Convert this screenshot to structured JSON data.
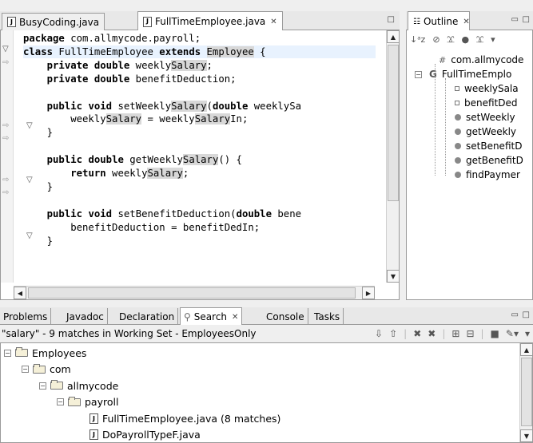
{
  "editor": {
    "tabs": [
      {
        "label": "BusyCoding.java",
        "active": false
      },
      {
        "label": "FullTimeEmployee.java",
        "active": true
      }
    ],
    "code": [
      [
        [
          "kw",
          "package"
        ],
        [
          "",
          " com.allmycode.payroll;"
        ]
      ],
      [
        [
          "kw",
          "class"
        ],
        [
          "",
          " FullTimeEmployee "
        ],
        [
          "kw",
          "extends"
        ],
        [
          "",
          " "
        ],
        [
          "hl",
          "Employee"
        ],
        [
          "",
          " {"
        ]
      ],
      [
        [
          "",
          "    "
        ],
        [
          "kw",
          "private"
        ],
        [
          "",
          " "
        ],
        [
          "kw",
          "double"
        ],
        [
          "",
          " weekly"
        ],
        [
          "hl",
          "Salary"
        ],
        [
          "",
          ";"
        ]
      ],
      [
        [
          "",
          "    "
        ],
        [
          "kw",
          "private"
        ],
        [
          "",
          " "
        ],
        [
          "kw",
          "double"
        ],
        [
          "",
          " benefitDeduction;"
        ]
      ],
      [
        [
          "",
          ""
        ]
      ],
      [
        [
          "",
          "    "
        ],
        [
          "kw",
          "public"
        ],
        [
          "",
          " "
        ],
        [
          "kw",
          "void"
        ],
        [
          "",
          " setWeekly"
        ],
        [
          "hl",
          "Salary"
        ],
        [
          "",
          "("
        ],
        [
          "kw",
          "double"
        ],
        [
          "",
          " weeklySa"
        ]
      ],
      [
        [
          "",
          "        weekly"
        ],
        [
          "hl",
          "Salary"
        ],
        [
          "",
          " = weekly"
        ],
        [
          "hl",
          "Salary"
        ],
        [
          "",
          "In;"
        ]
      ],
      [
        [
          "",
          "    }"
        ]
      ],
      [
        [
          "",
          ""
        ]
      ],
      [
        [
          "",
          "    "
        ],
        [
          "kw",
          "public"
        ],
        [
          "",
          " "
        ],
        [
          "kw",
          "double"
        ],
        [
          "",
          " getWeekly"
        ],
        [
          "hl",
          "Salary"
        ],
        [
          "",
          "() {"
        ]
      ],
      [
        [
          "",
          "        "
        ],
        [
          "kw",
          "return"
        ],
        [
          "",
          " weekly"
        ],
        [
          "hl",
          "Salary"
        ],
        [
          "",
          ";"
        ]
      ],
      [
        [
          "",
          "    }"
        ]
      ],
      [
        [
          "",
          ""
        ]
      ],
      [
        [
          "",
          "    "
        ],
        [
          "kw",
          "public"
        ],
        [
          "",
          " "
        ],
        [
          "kw",
          "void"
        ],
        [
          "",
          " setBenefitDeduction("
        ],
        [
          "kw",
          "double"
        ],
        [
          "",
          " bene"
        ]
      ],
      [
        [
          "",
          "        benefitDeduction = benefitDedIn;"
        ]
      ],
      [
        [
          "",
          "    }"
        ]
      ]
    ]
  },
  "outline": {
    "tab_label": "Outline",
    "items": [
      {
        "label": "com.allmycode",
        "kind": "package"
      },
      {
        "label": "FullTimeEmplo",
        "kind": "class"
      },
      {
        "label": "weeklySala",
        "kind": "field"
      },
      {
        "label": "benefitDed",
        "kind": "field"
      },
      {
        "label": "setWeekly",
        "kind": "method"
      },
      {
        "label": "getWeekly",
        "kind": "method"
      },
      {
        "label": "setBenefitD",
        "kind": "method"
      },
      {
        "label": "getBenefitD",
        "kind": "method"
      },
      {
        "label": "findPaymer",
        "kind": "method"
      }
    ]
  },
  "bottom": {
    "tabs": [
      "Problems",
      "Javadoc",
      "Declaration",
      "Search",
      "Console",
      "Tasks"
    ],
    "active_tab": "Search",
    "search_summary": "\"salary\" - 9 matches in Working Set - EmployeesOnly",
    "tree": [
      {
        "label": "Employees",
        "level": 0,
        "kind": "project"
      },
      {
        "label": "com",
        "level": 1,
        "kind": "folder"
      },
      {
        "label": "allmycode",
        "level": 2,
        "kind": "folder"
      },
      {
        "label": "payroll",
        "level": 3,
        "kind": "folder"
      },
      {
        "label": "FullTimeEmployee.java (8 matches)",
        "level": 4,
        "kind": "file"
      },
      {
        "label": "DoPayrollTypeF.java",
        "level": 4,
        "kind": "file"
      }
    ]
  }
}
